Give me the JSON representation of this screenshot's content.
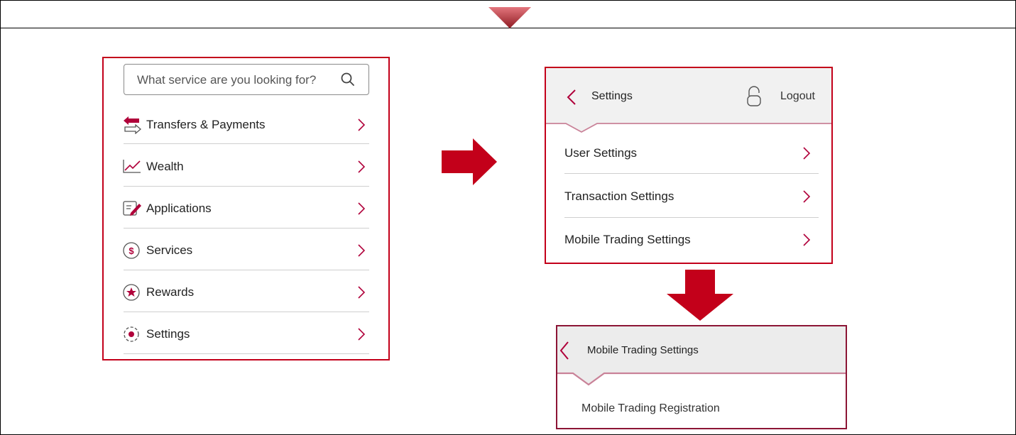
{
  "colors": {
    "accent": "#c3001a",
    "arrow": "#c3001a",
    "icon": "#b0003a"
  },
  "menu": {
    "search_placeholder": "What service are you looking for?",
    "items": [
      {
        "label": "Transfers & Payments",
        "icon": "transfer-icon"
      },
      {
        "label": "Wealth",
        "icon": "chart-line-icon"
      },
      {
        "label": "Applications",
        "icon": "edit-document-icon"
      },
      {
        "label": "Services",
        "icon": "dollar-circle-icon"
      },
      {
        "label": "Rewards",
        "icon": "star-circle-icon"
      },
      {
        "label": "Settings",
        "icon": "gear-icon"
      }
    ]
  },
  "settings_panel": {
    "title": "Settings",
    "logout_label": "Logout",
    "items": [
      "User Settings",
      "Transaction Settings",
      "Mobile Trading Settings"
    ]
  },
  "mobile_trading_panel": {
    "title": "Mobile Trading Settings",
    "items": [
      "Mobile Trading Registration"
    ]
  }
}
